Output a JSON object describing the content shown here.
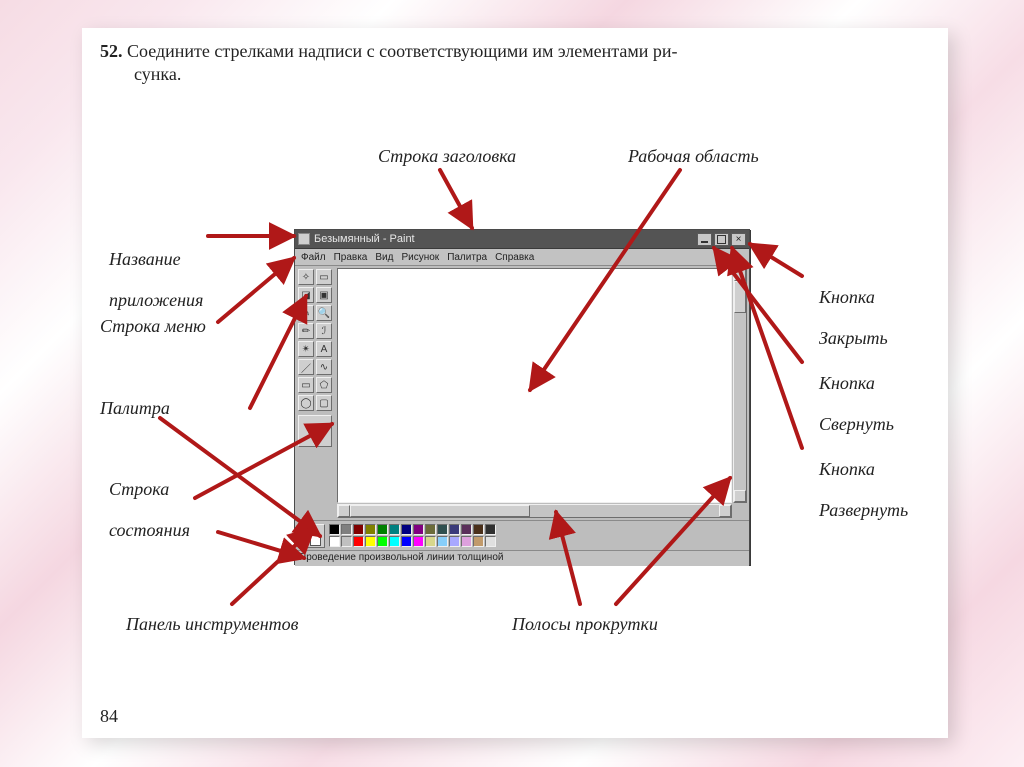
{
  "task": {
    "number": "52.",
    "text_line1": "Соедините стрелками надписи с соответствующими им элементами ри-",
    "text_line2": "сунка."
  },
  "labels": {
    "title_bar": "Строка заголовка",
    "work_area": "Рабочая область",
    "app_name_l1": "Название",
    "app_name_l2": "приложения",
    "menu_bar": "Строка меню",
    "palette": "Палитра",
    "status_l1": "Строка",
    "status_l2": "состояния",
    "toolbox": "Панель инструментов",
    "scrollbars": "Полосы прокрутки",
    "close_l1": "Кнопка",
    "close_l2": "Закрыть",
    "min_l1": "Кнопка",
    "min_l2": "Свернуть",
    "max_l1": "Кнопка",
    "max_l2": "Развернуть"
  },
  "paint": {
    "title": "Безымянный - Paint",
    "menu": [
      "Файл",
      "Правка",
      "Вид",
      "Рисунок",
      "Палитра",
      "Справка"
    ],
    "status": "Проведение произвольной линии толщиной",
    "palette_colors": [
      "#000000",
      "#ffffff",
      "#7f7f7f",
      "#c0c0c0",
      "#800000",
      "#ff0000",
      "#808000",
      "#ffff00",
      "#008000",
      "#00ff00",
      "#008080",
      "#00ffff",
      "#000080",
      "#0000ff",
      "#800080",
      "#ff00ff",
      "#6b6b3a",
      "#d7d78c",
      "#2f4f4f",
      "#87cefa",
      "#3a3a7a",
      "#a8a8ff",
      "#5a2f5a",
      "#dda0dd",
      "#4a2f1a",
      "#c19a6b",
      "#303030",
      "#e0e0e0"
    ]
  },
  "page_number": "84",
  "colors": {
    "arrow": "#b01818"
  }
}
